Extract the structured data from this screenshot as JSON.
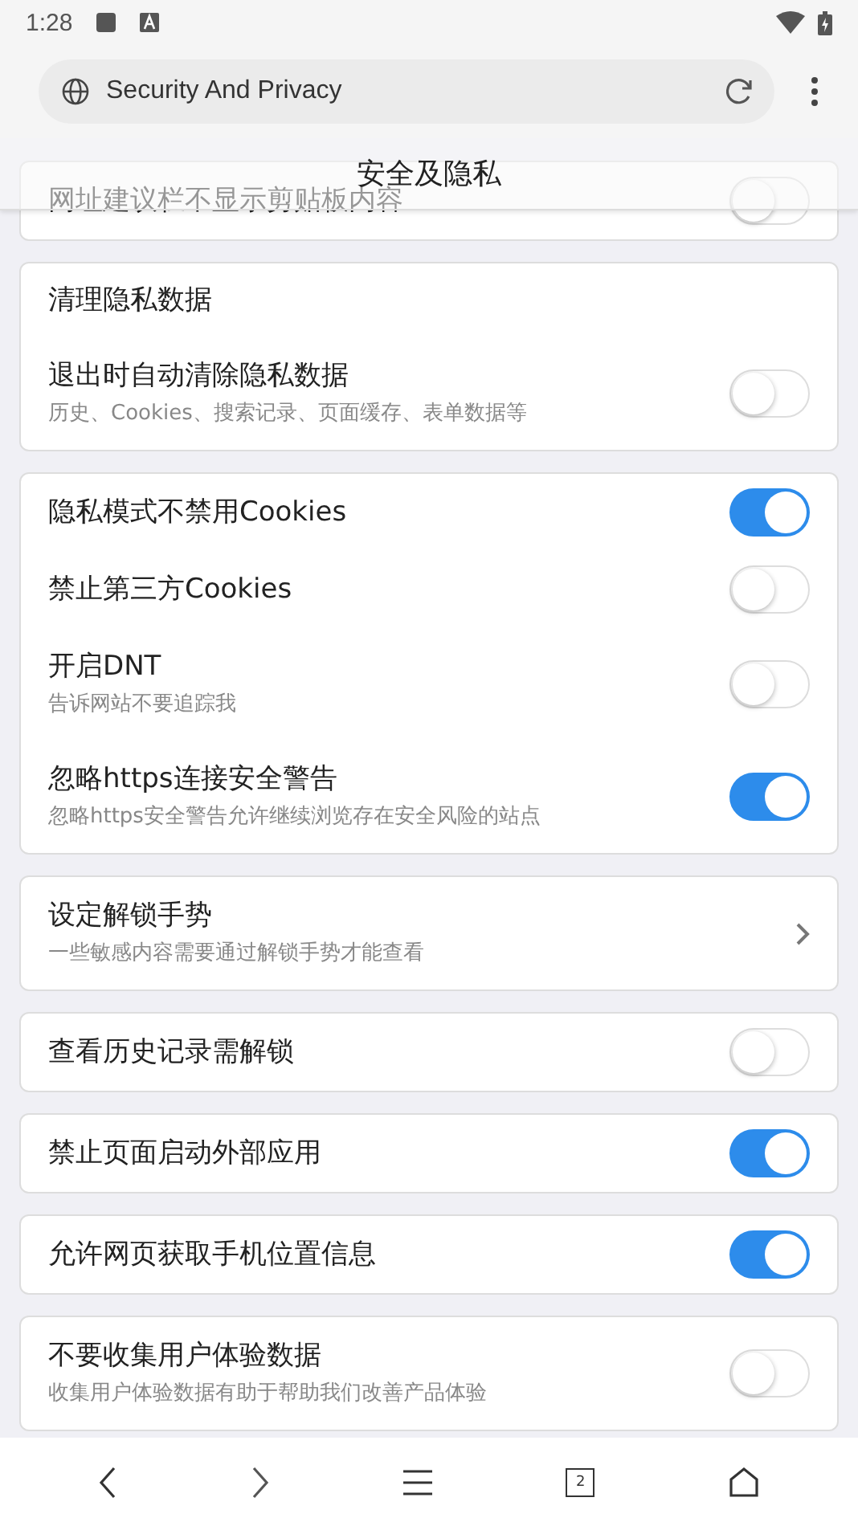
{
  "status_bar": {
    "time": "1:28"
  },
  "url_bar": {
    "title": "Security And Privacy"
  },
  "page_title": "安全及隐私",
  "sections": [
    {
      "rows": [
        {
          "kind": "toggle",
          "title": "网址建议栏不显示剪贴板内容",
          "on": false
        }
      ]
    },
    {
      "heading": "清理隐私数据",
      "rows": [
        {
          "kind": "toggle",
          "title": "退出时自动清除隐私数据",
          "subtitle": "历史、Cookies、搜索记录、页面缓存、表单数据等",
          "on": false
        }
      ]
    },
    {
      "rows": [
        {
          "kind": "toggle",
          "title": "隐私模式不禁用Cookies",
          "on": true
        },
        {
          "kind": "toggle",
          "title": "禁止第三方Cookies",
          "on": false
        },
        {
          "kind": "toggle",
          "title": "开启DNT",
          "subtitle": "告诉网站不要追踪我",
          "on": false
        },
        {
          "kind": "toggle",
          "title": "忽略https连接安全警告",
          "subtitle": "忽略https安全警告允许继续浏览存在安全风险的站点",
          "on": true
        }
      ]
    },
    {
      "rows": [
        {
          "kind": "link",
          "title": "设定解锁手势",
          "subtitle": "一些敏感内容需要通过解锁手势才能查看"
        }
      ]
    },
    {
      "rows": [
        {
          "kind": "toggle",
          "title": "查看历史记录需解锁",
          "on": false
        }
      ]
    },
    {
      "rows": [
        {
          "kind": "toggle",
          "title": "禁止页面启动外部应用",
          "on": true
        }
      ]
    },
    {
      "rows": [
        {
          "kind": "toggle",
          "title": "允许网页获取手机位置信息",
          "on": true
        }
      ]
    },
    {
      "rows": [
        {
          "kind": "toggle",
          "title": "不要收集用户体验数据",
          "subtitle": "收集用户体验数据有助于帮助我们改善产品体验",
          "on": false
        }
      ]
    }
  ],
  "bottom_nav": {
    "tab_count": "2"
  }
}
